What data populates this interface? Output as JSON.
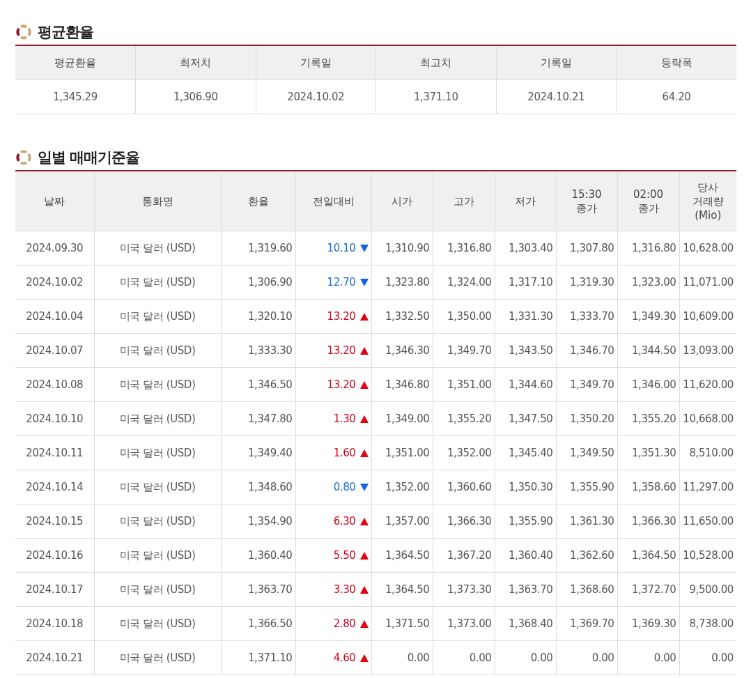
{
  "summary": {
    "title": "평균환율",
    "columns": [
      "평균환율",
      "최저치",
      "기록일",
      "최고치",
      "기록일",
      "등락폭"
    ],
    "values": [
      "1,345.29",
      "1,306.90",
      "2024.10.02",
      "1,371.10",
      "2024.10.21",
      "64.20"
    ]
  },
  "daily": {
    "title": "일별 매매기준율",
    "columns": [
      "날짜",
      "통화명",
      "환율",
      "전일대비",
      "시가",
      "고가",
      "저가",
      "15:30\n종가",
      "02:00\n종가",
      "당사\n거래량\n(Mio)"
    ],
    "rows": [
      {
        "date": "2024.09.30",
        "currency": "미국 달러 (USD)",
        "rate": "1,319.60",
        "change": "10.10",
        "kind": "down",
        "open": "1,310.90",
        "high": "1,316.80",
        "low": "1,303.40",
        "close1530": "1,307.80",
        "close0200": "1,316.80",
        "volume": "10,628.00"
      },
      {
        "date": "2024.10.02",
        "currency": "미국 달러 (USD)",
        "rate": "1,306.90",
        "change": "12.70",
        "kind": "down",
        "open": "1,323.80",
        "high": "1,324.00",
        "low": "1,317.10",
        "close1530": "1,319.30",
        "close0200": "1,323.00",
        "volume": "11,071.00"
      },
      {
        "date": "2024.10.04",
        "currency": "미국 달러 (USD)",
        "rate": "1,320.10",
        "change": "13.20",
        "kind": "up",
        "open": "1,332.50",
        "high": "1,350.00",
        "low": "1,331.30",
        "close1530": "1,333.70",
        "close0200": "1,349.30",
        "volume": "10,609.00"
      },
      {
        "date": "2024.10.07",
        "currency": "미국 달러 (USD)",
        "rate": "1,333.30",
        "change": "13.20",
        "kind": "up",
        "open": "1,346.30",
        "high": "1,349.70",
        "low": "1,343.50",
        "close1530": "1,346.70",
        "close0200": "1,344.50",
        "volume": "13,093.00"
      },
      {
        "date": "2024.10.08",
        "currency": "미국 달러 (USD)",
        "rate": "1,346.50",
        "change": "13.20",
        "kind": "up",
        "open": "1,346.80",
        "high": "1,351.00",
        "low": "1,344.60",
        "close1530": "1,349.70",
        "close0200": "1,346.00",
        "volume": "11,620.00"
      },
      {
        "date": "2024.10.10",
        "currency": "미국 달러 (USD)",
        "rate": "1,347.80",
        "change": "1.30",
        "kind": "up",
        "open": "1,349.00",
        "high": "1,355.20",
        "low": "1,347.50",
        "close1530": "1,350.20",
        "close0200": "1,355.20",
        "volume": "10,668.00"
      },
      {
        "date": "2024.10.11",
        "currency": "미국 달러 (USD)",
        "rate": "1,349.40",
        "change": "1.60",
        "kind": "up",
        "open": "1,351.00",
        "high": "1,352.00",
        "low": "1,345.40",
        "close1530": "1,349.50",
        "close0200": "1,351.30",
        "volume": "8,510.00"
      },
      {
        "date": "2024.10.14",
        "currency": "미국 달러 (USD)",
        "rate": "1,348.60",
        "change": "0.80",
        "kind": "down",
        "open": "1,352.00",
        "high": "1,360.60",
        "low": "1,350.30",
        "close1530": "1,355.90",
        "close0200": "1,358.60",
        "volume": "11,297.00"
      },
      {
        "date": "2024.10.15",
        "currency": "미국 달러 (USD)",
        "rate": "1,354.90",
        "change": "6.30",
        "kind": "up",
        "open": "1,357.00",
        "high": "1,366.30",
        "low": "1,355.90",
        "close1530": "1,361.30",
        "close0200": "1,366.30",
        "volume": "11,650.00"
      },
      {
        "date": "2024.10.16",
        "currency": "미국 달러 (USD)",
        "rate": "1,360.40",
        "change": "5.50",
        "kind": "up",
        "open": "1,364.50",
        "high": "1,367.20",
        "low": "1,360.40",
        "close1530": "1,362.60",
        "close0200": "1,364.50",
        "volume": "10,528.00"
      },
      {
        "date": "2024.10.17",
        "currency": "미국 달러 (USD)",
        "rate": "1,363.70",
        "change": "3.30",
        "kind": "up",
        "open": "1,364.50",
        "high": "1,373.30",
        "low": "1,363.70",
        "close1530": "1,368.60",
        "close0200": "1,372.70",
        "volume": "9,500.00"
      },
      {
        "date": "2024.10.18",
        "currency": "미국 달러 (USD)",
        "rate": "1,366.50",
        "change": "2.80",
        "kind": "up",
        "open": "1,371.50",
        "high": "1,373.00",
        "low": "1,368.40",
        "close1530": "1,369.70",
        "close0200": "1,369.30",
        "volume": "8,738.00"
      },
      {
        "date": "2024.10.21",
        "currency": "미국 달러 (USD)",
        "rate": "1,371.10",
        "change": "4.60",
        "kind": "up",
        "open": "0.00",
        "high": "0.00",
        "low": "0.00",
        "close1530": "0.00",
        "close0200": "0.00",
        "volume": "0.00"
      }
    ]
  }
}
